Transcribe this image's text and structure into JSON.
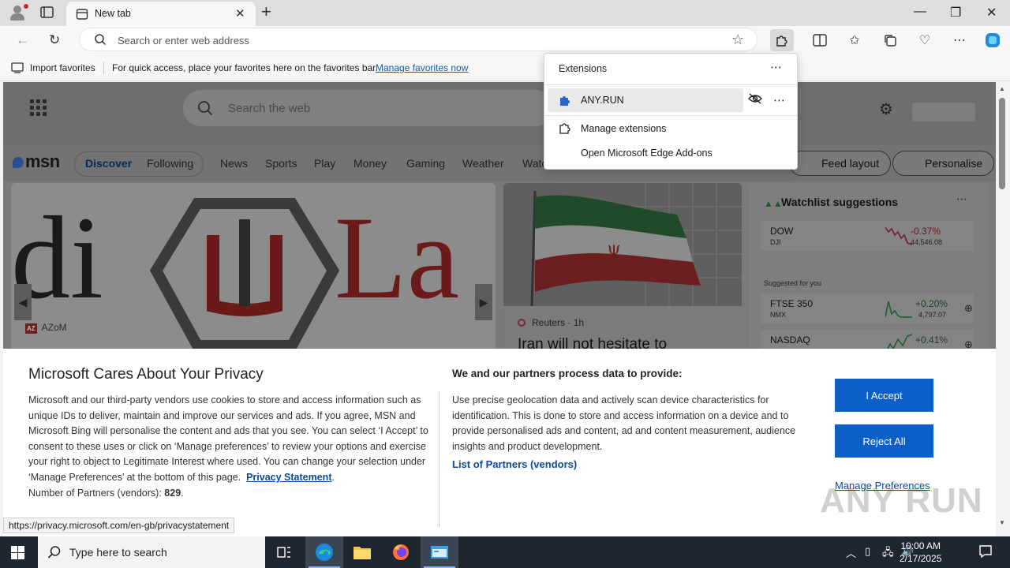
{
  "browser": {
    "tab_title": "New tab",
    "address_placeholder": "Search or enter web address"
  },
  "favorites_bar": {
    "import_label": "Import favorites",
    "hint": "For quick access, place your favorites here on the favorites bar.",
    "manage_link": "Manage favorites now"
  },
  "extensions_popup": {
    "title": "Extensions",
    "items": [
      {
        "name": "ANY.RUN"
      }
    ],
    "manage_label": "Manage extensions",
    "addons_label": "Open Microsoft Edge Add-ons"
  },
  "msn": {
    "search_placeholder": "Search the web",
    "logo": "msn",
    "nav": [
      {
        "label": "Discover",
        "selected": true
      },
      {
        "label": "Following"
      },
      {
        "label": "News"
      },
      {
        "label": "Sports"
      },
      {
        "label": "Play"
      },
      {
        "label": "Money"
      },
      {
        "label": "Gaming"
      },
      {
        "label": "Weather"
      },
      {
        "label": "Watc"
      }
    ],
    "feed_layout_label": "Feed layout",
    "personalise_label": "Personalise",
    "card_a": {
      "source_badge": "AZ",
      "source": "AZoM"
    },
    "card_b": {
      "source": "Reuters",
      "age": "1h",
      "headline": "Iran will not hesitate to"
    },
    "watchlist": {
      "title": "Watchlist suggestions",
      "stocks": [
        {
          "symbol": "DOW",
          "exchange": "DJI",
          "change": "-0.37%",
          "value": "44,546.08",
          "positive": false
        }
      ],
      "suggested_label": "Suggested for you",
      "suggested": [
        {
          "symbol": "FTSE 350",
          "exchange": "NMX",
          "change": "+0.20%",
          "value": "4,797.07",
          "positive": true
        },
        {
          "symbol": "NASDAQ",
          "exchange": "",
          "change": "+0.41%",
          "value": "",
          "positive": true
        }
      ]
    }
  },
  "privacy": {
    "title": "Microsoft Cares About Your Privacy",
    "body": "Microsoft and our third-party vendors use cookies to store and access information such as unique IDs to deliver, maintain and improve our services and ads. If you agree, MSN and Microsoft Bing will personalise the content and ads that you see. You can select ‘I Accept’ to consent to these uses or click on ‘Manage preferences’ to review your options and exercise your right to object to Legitimate Interest where used.  You can change your selection under ‘Manage Preferences’ at the bottom of this page.",
    "privacy_link": "Privacy Statement",
    "partners_prefix": "Number of Partners (vendors):",
    "partners_count": "829",
    "heading2": "We and our partners process data to provide:",
    "body2": "Use precise geolocation data and actively scan device characteristics for identification. This is done to store and access information on a device and to provide personalised ads and content, ad and content measurement, audience insights and product development.",
    "partners_link": "List of Partners (vendors)",
    "accept_label": "I Accept",
    "reject_label": "Reject All",
    "manage_label": "Manage Preferences"
  },
  "status_url": "https://privacy.microsoft.com/en-gb/privacystatement",
  "watermark": "ANY RUN",
  "taskbar": {
    "search_placeholder": "Type here to search",
    "time": "10:00 AM",
    "date": "2/17/2025"
  },
  "colors": {
    "accent_blue": "#0b5fc7",
    "link_blue": "#0a4a9c",
    "negative": "#b42318",
    "positive": "#1d6b30"
  }
}
